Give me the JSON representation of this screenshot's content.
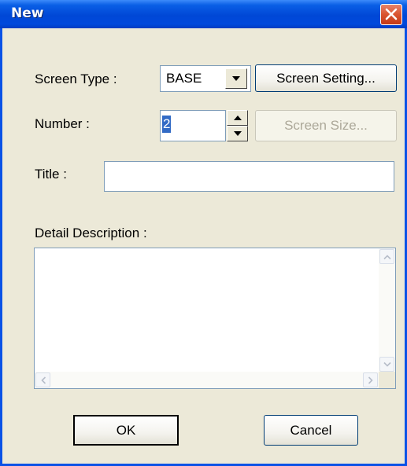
{
  "window": {
    "title": "New"
  },
  "labels": {
    "screen_type": "Screen Type :",
    "number": "Number :",
    "title": "Title :",
    "detail_description": "Detail Description :"
  },
  "screen_type": {
    "value": "BASE"
  },
  "number": {
    "value": "2"
  },
  "title_field": {
    "value": ""
  },
  "detail_field": {
    "value": ""
  },
  "buttons": {
    "screen_setting": "Screen Setting...",
    "screen_size": "Screen Size...",
    "ok": "OK",
    "cancel": "Cancel"
  },
  "icons": {
    "close": "close-icon",
    "dropdown": "chevron-down-icon",
    "spin_up": "triangle-up-icon",
    "spin_down": "triangle-down-icon",
    "scroll_up": "chevron-up-icon",
    "scroll_down": "chevron-down-icon",
    "scroll_left": "chevron-left-icon",
    "scroll_right": "chevron-right-icon"
  },
  "colors": {
    "titlebar": "#0047d6",
    "dialog_bg": "#ece9d8",
    "selection": "#316ac5",
    "close_button": "#d9542f"
  }
}
